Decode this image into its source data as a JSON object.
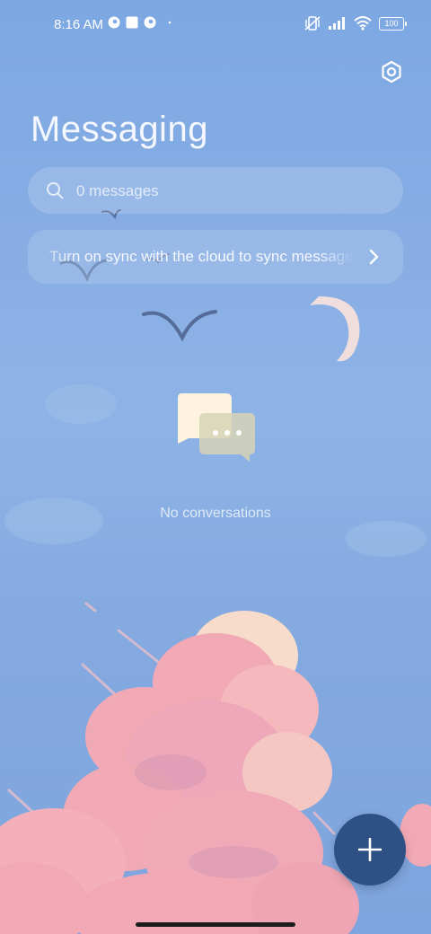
{
  "status_bar": {
    "time": "8:16 AM",
    "battery": "100",
    "left_icons": [
      "app-notification-icon",
      "square-notification-icon",
      "app-notification-icon",
      "dot-icon"
    ],
    "right_icons": [
      "vibrate-off-icon",
      "signal-icon",
      "wifi-icon",
      "battery-icon"
    ]
  },
  "header": {
    "title": "Messaging",
    "settings_icon": "settings-icon"
  },
  "search": {
    "placeholder": "0 messages",
    "icon": "search-icon"
  },
  "sync_banner": {
    "text": "Turn on sync with the cloud to sync messages",
    "icon": "chevron-right-icon"
  },
  "empty_state": {
    "icon": "chat-bubbles-icon",
    "text": "No conversations"
  },
  "fab": {
    "icon": "plus-icon",
    "color": "#2d5184"
  },
  "colors": {
    "sky": "#87ade4",
    "cloud_pink": "#f2a9b6",
    "fab": "#2d5184"
  }
}
